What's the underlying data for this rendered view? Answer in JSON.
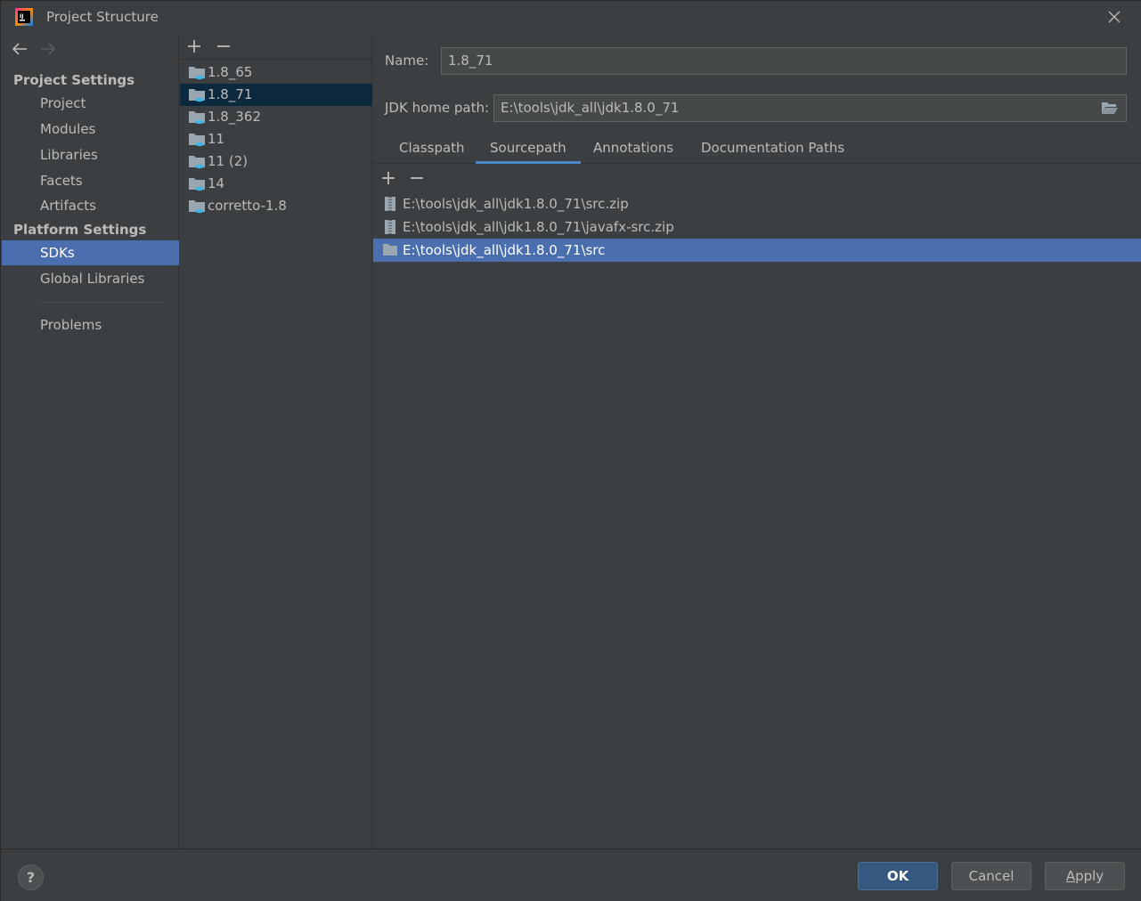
{
  "window": {
    "title": "Project Structure"
  },
  "nav": {
    "project_settings_label": "Project Settings",
    "project_settings_items": [
      "Project",
      "Modules",
      "Libraries",
      "Facets",
      "Artifacts"
    ],
    "platform_settings_label": "Platform Settings",
    "platform_settings_items": [
      "SDKs",
      "Global Libraries"
    ],
    "problems_label": "Problems",
    "selected": "SDKs"
  },
  "sdks": {
    "items": [
      "1.8_65",
      "1.8_71",
      "1.8_362",
      "11",
      "11 (2)",
      "14",
      "corretto-1.8"
    ],
    "selected": "1.8_71"
  },
  "detail": {
    "name_label": "Name:",
    "name_value": "1.8_71",
    "jdk_home_label": "JDK home path:",
    "jdk_home_value": "E:\\tools\\jdk_all\\jdk1.8.0_71",
    "tabs": [
      "Classpath",
      "Sourcepath",
      "Annotations",
      "Documentation Paths"
    ],
    "active_tab": "Sourcepath",
    "paths": [
      {
        "text": "E:\\tools\\jdk_all\\jdk1.8.0_71\\src.zip",
        "icon": "zip-archive-icon"
      },
      {
        "text": "E:\\tools\\jdk_all\\jdk1.8.0_71\\javafx-src.zip",
        "icon": "zip-archive-icon"
      },
      {
        "text": "E:\\tools\\jdk_all\\jdk1.8.0_71\\src",
        "icon": "folder-icon"
      }
    ],
    "selected_path": "E:\\tools\\jdk_all\\jdk1.8.0_71\\src"
  },
  "footer": {
    "help_label": "?",
    "ok_label": "OK",
    "cancel_label": "Cancel",
    "apply_label": "Apply"
  },
  "colors": {
    "background": "#3c3f41",
    "selection": "#4b6eaf",
    "inactive_selection": "#0d293e",
    "tab_underline": "#4a88c7",
    "primary_button": "#365880"
  }
}
